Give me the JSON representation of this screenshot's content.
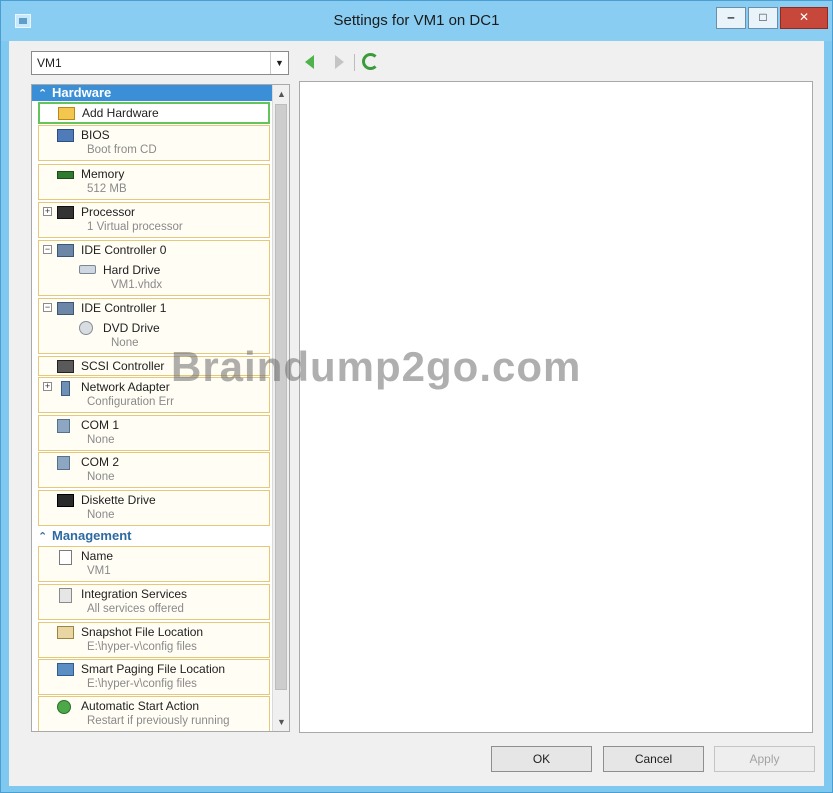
{
  "window": {
    "title": "Settings for VM1 on DC1",
    "minimize_glyph": "‒",
    "maximize_glyph": "□",
    "close_glyph": "✕"
  },
  "toolbar": {
    "vm_selector": {
      "value": "VM1",
      "arrow": "▼"
    }
  },
  "tree": {
    "hardware": {
      "header": "Hardware",
      "items": [
        {
          "label": "Add Hardware",
          "sub": ""
        },
        {
          "label": "BIOS",
          "sub": "Boot from CD"
        },
        {
          "label": "Memory",
          "sub": "512 MB"
        },
        {
          "label": "Processor",
          "sub": "1 Virtual processor",
          "expander": "+"
        },
        {
          "label": "IDE Controller 0",
          "expander": "−",
          "child": {
            "label": "Hard Drive",
            "sub": "VM1.vhdx"
          }
        },
        {
          "label": "IDE Controller 1",
          "expander": "−",
          "child": {
            "label": "DVD Drive",
            "sub": "None"
          }
        },
        {
          "label": "SCSI Controller",
          "sub": ""
        },
        {
          "label": "Network Adapter",
          "sub": "Configuration Err",
          "expander": "+"
        },
        {
          "label": "COM 1",
          "sub": "None"
        },
        {
          "label": "COM 2",
          "sub": "None"
        },
        {
          "label": "Diskette Drive",
          "sub": "None"
        }
      ]
    },
    "management": {
      "header": "Management",
      "items": [
        {
          "label": "Name",
          "sub": "VM1"
        },
        {
          "label": "Integration Services",
          "sub": "All services offered"
        },
        {
          "label": "Snapshot File Location",
          "sub": "E:\\hyper-v\\config files"
        },
        {
          "label": "Smart Paging File Location",
          "sub": "E:\\hyper-v\\config files"
        },
        {
          "label": "Automatic Start Action",
          "sub": "Restart if previously running"
        }
      ]
    },
    "collapse_glyph": "⌃",
    "scroll_up": "▲",
    "scroll_down": "▼"
  },
  "buttons": {
    "ok": "OK",
    "cancel": "Cancel",
    "apply": "Apply"
  },
  "watermark": "Braindump2go.com",
  "colors": {
    "titlebar": "#89cdf3",
    "section_header_active": "#3a8fd6",
    "selection": "#62c45a",
    "item_border": "#e5c97a"
  }
}
